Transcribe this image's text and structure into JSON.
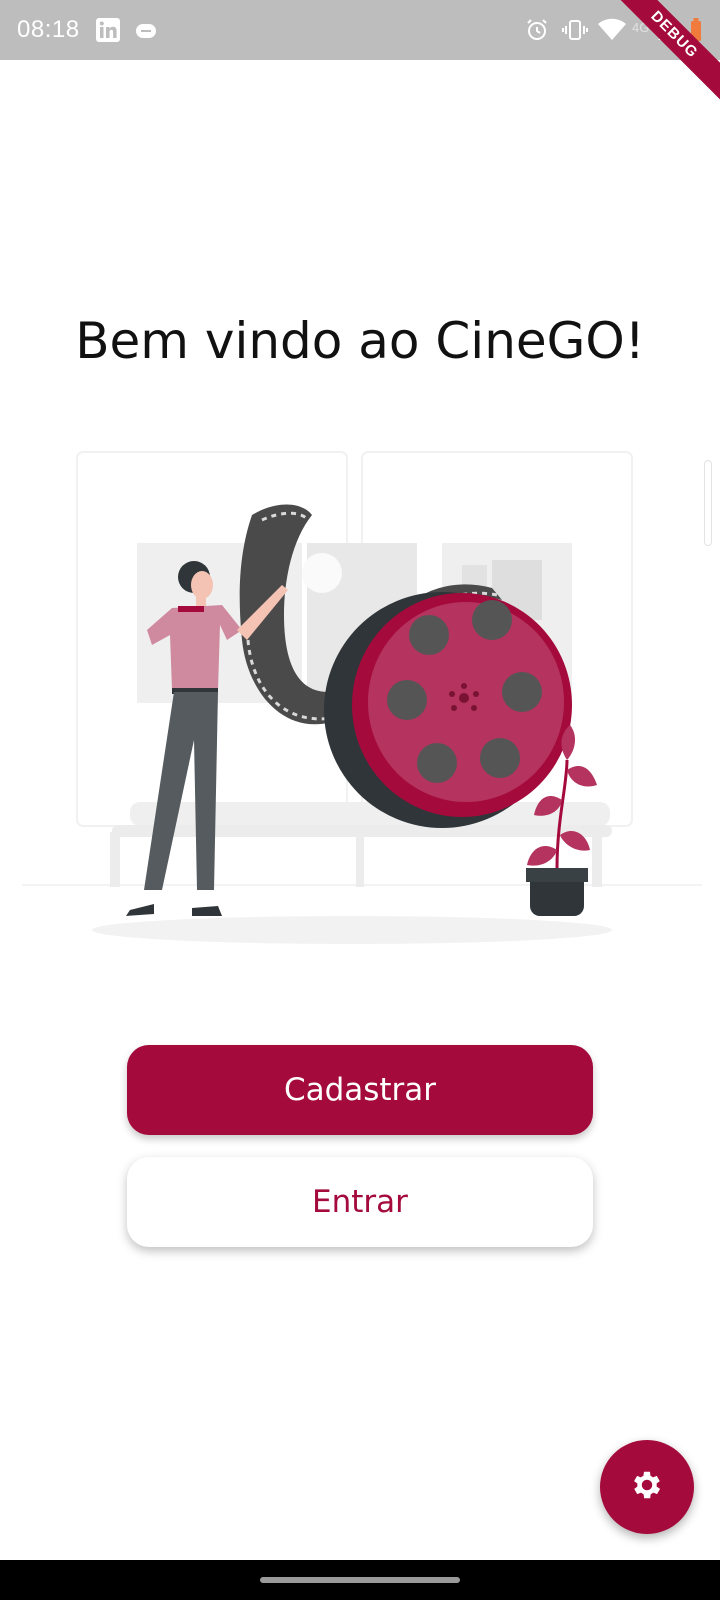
{
  "status_bar": {
    "time": "08:18",
    "network_label": "4G",
    "icons": [
      "linkedin-icon",
      "app-notification-icon",
      "alarm-icon",
      "vibrate-icon",
      "wifi-icon",
      "signal-icon",
      "battery-icon"
    ]
  },
  "debug_banner": "DEBUG",
  "welcome": {
    "title": "Bem vindo ao CineGO!"
  },
  "illustration": {
    "subject": "man-with-film-reel",
    "accent": "#b5335f"
  },
  "actions": {
    "signup_label": "Cadastrar",
    "login_label": "Entrar"
  },
  "fab": {
    "icon": "gear-icon"
  },
  "colors": {
    "primary": "#a40a3c",
    "background": "#ffffff",
    "status_bar": "#bdbdbd"
  }
}
